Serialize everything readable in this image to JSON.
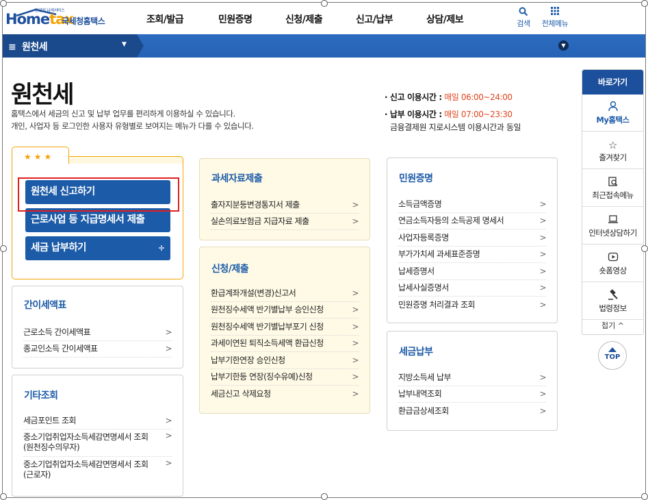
{
  "header": {
    "logo_small": "안녕의 납세서비스",
    "logo_main_pre": "Home",
    "logo_main_post": "tax",
    "logo_sub": "국세청홈택스",
    "menu": [
      "조회/발급",
      "민원증명",
      "신청/제출",
      "신고/납부",
      "상담/제보"
    ],
    "search_label": "검색",
    "all_menu_label": "전체메뉴"
  },
  "navbar": {
    "current": "원천세"
  },
  "page": {
    "title": "원천세",
    "desc1": "홈택스에서 세금의 신고 및 납부 업무를 편리하게 이용하실 수 있습니다.",
    "desc2": "개인, 사업자 등 로그인한 사용자 유형별로 보여지는 메뉴가 다를 수 있습니다.",
    "report_hours_label": "· 신고 이용시간 :",
    "report_hours_value": "매일 06:00~24:00",
    "pay_hours_label": "· 납부 이용시간 :",
    "pay_hours_value": "매일 07:00~23:30",
    "pay_hours_note": "금융결제원 지로시스템 이용시간과 동일"
  },
  "favorites": {
    "stars": "★★★",
    "buttons": [
      "원천세 신고하기",
      "근로사업 등 지급명세서 제출",
      "세금 납부하기"
    ]
  },
  "simple_tax": {
    "title": "간이세액표",
    "items": [
      "근로소득 간이세액표",
      "종교인소득 간이세액표"
    ]
  },
  "other_lookup": {
    "title": "기타조회",
    "items": [
      "세금포인트 조회",
      "중소기업취업자소득세감면명세서 조회\n(원천징수의무자)",
      "중소기업취업자소득세감면명세서 조회\n(근로자)"
    ]
  },
  "tax_submit": {
    "title": "과세자료제출",
    "items": [
      "출자지분등변경통지서 제출",
      "실손의료보험금 지급자료 제출"
    ]
  },
  "apply_submit": {
    "title": "신청/제출",
    "items": [
      "환급계좌개설(변경)신고서",
      "원천징수세액 반기별납부 승인신청",
      "원천징수세액 반기별납부포기 신청",
      "과세이연된 퇴직소득세액 환급신청",
      "납부기한연장 승인신청",
      "납부기한등 연장(징수유예)신청",
      "세금신고 삭제요청"
    ]
  },
  "civil_cert": {
    "title": "민원증명",
    "items": [
      "소득금액증명",
      "연금소득자등의 소득공제 명세서",
      "사업자등록증명",
      "부가가치세 과세표준증명",
      "납세증명서",
      "납세사실증명서",
      "민원증명 처리결과 조회"
    ]
  },
  "tax_payment": {
    "title": "세금납부",
    "items": [
      "지방소득세 납부",
      "납부내역조회",
      "환급금상세조회"
    ]
  },
  "quick": {
    "title": "바로가기",
    "items": [
      "My홈택스",
      "즐겨찾기",
      "최근접속메뉴",
      "인터넷상담하기",
      "숏폼영상",
      "법령정보"
    ],
    "fold": "접기 ^",
    "top": "TOP"
  },
  "colors": {
    "brand": "#1c5ba8",
    "accent": "#f4a300",
    "highlight": "#e01e1e",
    "time": "#e0451d"
  }
}
